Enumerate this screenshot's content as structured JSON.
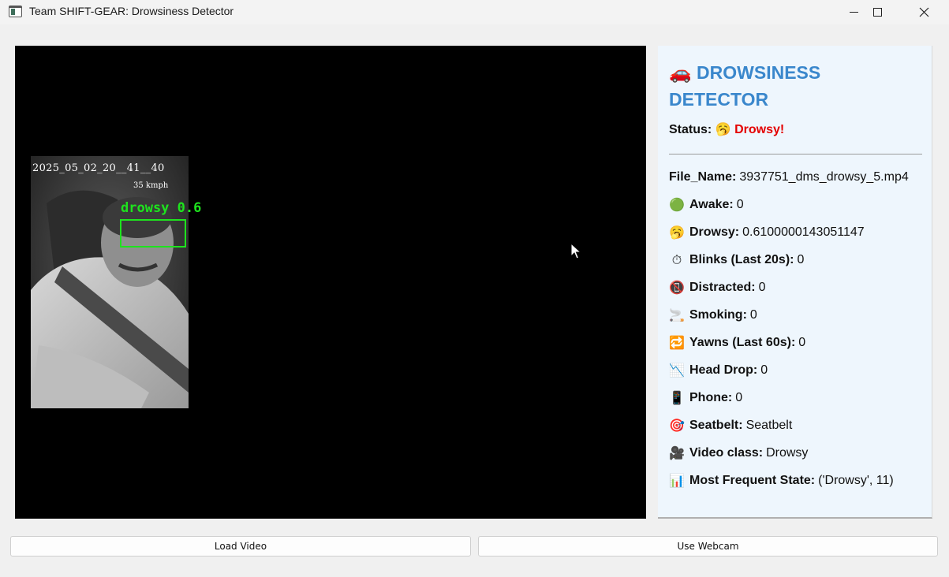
{
  "window": {
    "title": "Team SHIFT-GEAR: Drowsiness Detector"
  },
  "video": {
    "overlay_timestamp": "2025_05_02_20__41__40",
    "overlay_speed": "35 kmph",
    "detection_label": "drowsy 0.6"
  },
  "panel": {
    "heading_icon": "🚗",
    "heading": "DROWSINESS DETECTOR",
    "status_label": "Status:",
    "status_icon": "🥱",
    "status_value": "Drowsy!",
    "status_color": "#e40000",
    "rows": [
      {
        "icon": "",
        "label": "File_Name:",
        "value": "3937751_dms_drowsy_5.mp4"
      },
      {
        "icon": "🟢",
        "label": "Awake:",
        "value": "0"
      },
      {
        "icon": "🥱",
        "label": "Drowsy:",
        "value": "0.6100000143051147"
      },
      {
        "icon": "⏱",
        "label": "Blinks (Last 20s):",
        "value": "0"
      },
      {
        "icon": "📵",
        "label": "Distracted:",
        "value": "0"
      },
      {
        "icon": "🚬",
        "label": "Smoking:",
        "value": "0"
      },
      {
        "icon": "🔁",
        "label": "Yawns (Last 60s):",
        "value": "0"
      },
      {
        "icon": "📉",
        "label": "Head Drop:",
        "value": "0"
      },
      {
        "icon": "📱",
        "label": "Phone:",
        "value": "0"
      },
      {
        "icon": "🎯",
        "label": "Seatbelt:",
        "value": "Seatbelt"
      },
      {
        "icon": "🎥",
        "label": "Video class:",
        "value": "Drowsy"
      },
      {
        "icon": "📊",
        "label": "Most Frequent State:",
        "value": "('Drowsy', 11)"
      }
    ]
  },
  "buttons": {
    "load_video": "Load Video",
    "use_webcam": "Use Webcam"
  },
  "colors": {
    "heading": "#3a87cc",
    "detection": "#1ee31e",
    "panel_bg": "#eef6fd"
  }
}
